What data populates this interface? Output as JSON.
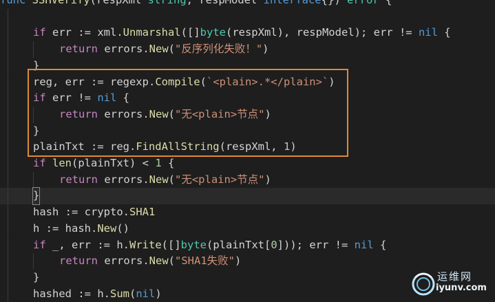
{
  "editor": {
    "lines": [
      {
        "tokens": [
          [
            "kw",
            "func"
          ],
          [
            "pk",
            " "
          ],
          [
            "fn",
            "SSHVerify"
          ],
          [
            "pk",
            "(respXml "
          ],
          [
            "ty",
            "string"
          ],
          [
            "pk",
            ", respModel "
          ],
          [
            "kw",
            "interface"
          ],
          [
            "pk",
            "{}) "
          ],
          [
            "ty",
            "error"
          ],
          [
            "pk",
            " {"
          ]
        ]
      },
      {
        "tokens": []
      },
      {
        "tokens": [
          [
            "ctl",
            "if"
          ],
          [
            "pk",
            " err := xml."
          ],
          [
            "fn",
            "Unmarshal"
          ],
          [
            "pk",
            "([]"
          ],
          [
            "ty",
            "byte"
          ],
          [
            "pk",
            "(respXml), respModel); err != "
          ],
          [
            "kw",
            "nil"
          ],
          [
            "pk",
            " {"
          ]
        ]
      },
      {
        "tokens": [
          [
            "ctl",
            "return"
          ],
          [
            "pk",
            " errors."
          ],
          [
            "fn",
            "New"
          ],
          [
            "pk",
            "("
          ],
          [
            "str",
            "\"反序列化失败！\""
          ],
          [
            "pk",
            ")"
          ]
        ]
      },
      {
        "tokens": [
          [
            "pk",
            "}"
          ]
        ]
      },
      {
        "tokens": [
          [
            "pk",
            "reg, err := regexp."
          ],
          [
            "fn",
            "Compile"
          ],
          [
            "pk",
            "("
          ],
          [
            "str",
            "`<plain>.*</plain>`"
          ],
          [
            "pk",
            ")"
          ]
        ]
      },
      {
        "tokens": [
          [
            "ctl",
            "if"
          ],
          [
            "pk",
            " err != "
          ],
          [
            "kw",
            "nil"
          ],
          [
            "pk",
            " {"
          ]
        ]
      },
      {
        "tokens": [
          [
            "ctl",
            "return"
          ],
          [
            "pk",
            " errors."
          ],
          [
            "fn",
            "New"
          ],
          [
            "pk",
            "("
          ],
          [
            "str",
            "\"无<plain>节点\""
          ],
          [
            "pk",
            ")"
          ]
        ]
      },
      {
        "tokens": [
          [
            "pk",
            "}"
          ]
        ]
      },
      {
        "tokens": [
          [
            "pk",
            "plainTxt := reg."
          ],
          [
            "fn",
            "FindAllString"
          ],
          [
            "pk",
            "(respXml, "
          ],
          [
            "num",
            "1"
          ],
          [
            "pk",
            ")"
          ]
        ]
      },
      {
        "tokens": [
          [
            "ctl",
            "if"
          ],
          [
            "pk",
            " "
          ],
          [
            "fn",
            "len"
          ],
          [
            "pk",
            "(plainTxt) < "
          ],
          [
            "num",
            "1"
          ],
          [
            "pk",
            " {"
          ]
        ]
      },
      {
        "tokens": [
          [
            "ctl",
            "return"
          ],
          [
            "pk",
            " errors."
          ],
          [
            "fn",
            "New"
          ],
          [
            "pk",
            "("
          ],
          [
            "str",
            "\"无<plain>节点\""
          ],
          [
            "pk",
            ")"
          ]
        ]
      },
      {
        "tokens": [
          [
            "pk",
            "}"
          ]
        ]
      },
      {
        "tokens": [
          [
            "pk",
            "hash := crypto."
          ],
          [
            "fn",
            "SHA1"
          ]
        ]
      },
      {
        "tokens": [
          [
            "pk",
            "h := hash."
          ],
          [
            "fn",
            "New"
          ],
          [
            "pk",
            "()"
          ]
        ]
      },
      {
        "tokens": [
          [
            "ctl",
            "if"
          ],
          [
            "pk",
            " _, err := h."
          ],
          [
            "fn",
            "Write"
          ],
          [
            "pk",
            "([]"
          ],
          [
            "ty",
            "byte"
          ],
          [
            "pk",
            "(plainTxt["
          ],
          [
            "num",
            "0"
          ],
          [
            "pk",
            "])); err != "
          ],
          [
            "kw",
            "nil"
          ],
          [
            "pk",
            " {"
          ]
        ]
      },
      {
        "tokens": [
          [
            "ctl",
            "return"
          ],
          [
            "pk",
            " errors."
          ],
          [
            "fn",
            "New"
          ],
          [
            "pk",
            "("
          ],
          [
            "str",
            "\"SHA1失败\""
          ],
          [
            "pk",
            ")"
          ]
        ]
      },
      {
        "tokens": [
          [
            "pk",
            "}"
          ]
        ]
      },
      {
        "tokens": [
          [
            "pk",
            "hashed := h."
          ],
          [
            "fn",
            "Sum"
          ],
          [
            "pk",
            "("
          ],
          [
            "kw",
            "nil"
          ],
          [
            "pk",
            ")"
          ]
        ]
      }
    ]
  },
  "watermark": {
    "title": "运维网",
    "url": "iyunv.com"
  },
  "colors": {
    "highlight_border": "#e08a34",
    "background": "#1e1e1e"
  }
}
